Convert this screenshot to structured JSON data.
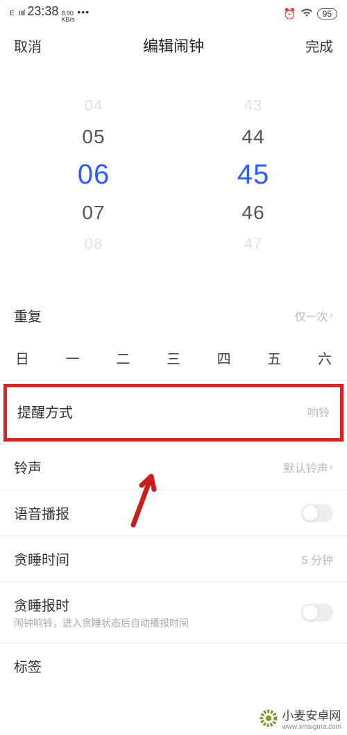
{
  "status": {
    "signal_label": "E",
    "signal_bars": "ıııl",
    "time": "23:38",
    "kbs": "8.90",
    "kbs_unit": "KB/s",
    "dots": "•••",
    "battery": "95"
  },
  "nav": {
    "cancel": "取消",
    "title": "编辑闹钟",
    "done": "完成"
  },
  "picker": {
    "hours": [
      "04",
      "05",
      "06",
      "07",
      "08"
    ],
    "minutes": [
      "43",
      "44",
      "45",
      "46",
      "47"
    ],
    "selected_index": 2
  },
  "repeat": {
    "label": "重复",
    "value": "仅一次"
  },
  "days": [
    "日",
    "一",
    "二",
    "三",
    "四",
    "五",
    "六"
  ],
  "reminder": {
    "label": "提醒方式",
    "value": "响铃"
  },
  "ringtone": {
    "label": "铃声",
    "value": "默认铃声"
  },
  "voice": {
    "label": "语音播报"
  },
  "snooze_time": {
    "label": "贪睡时间",
    "value": "5 分钟"
  },
  "snooze_report": {
    "label": "贪睡报时",
    "sub": "闹钟响铃，进入贪睡状态后自动播报时间"
  },
  "tag": {
    "label": "标签"
  },
  "watermark": {
    "text": "小麦安卓网",
    "url": "www.xmsigma.com"
  }
}
